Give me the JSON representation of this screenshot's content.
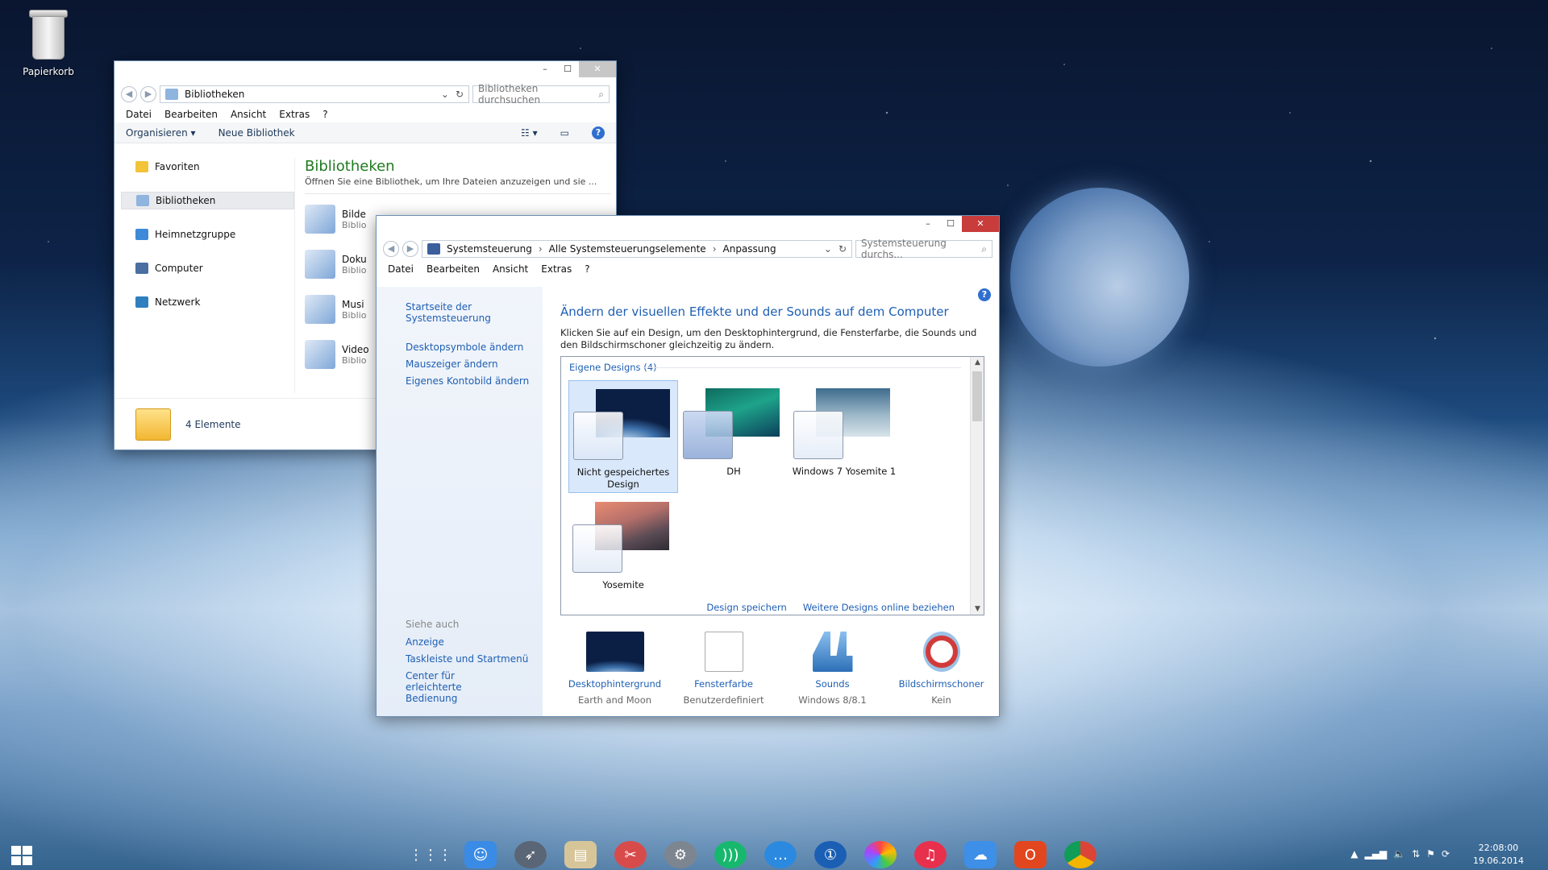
{
  "desktop": {
    "recycle_bin": "Papierkorb"
  },
  "explorer": {
    "title_buttons": {
      "min": "–",
      "max": "☐",
      "close": "✕"
    },
    "breadcrumb": [
      "Bibliotheken"
    ],
    "search_placeholder": "Bibliotheken durchsuchen",
    "menu": [
      "Datei",
      "Bearbeiten",
      "Ansicht",
      "Extras",
      "?"
    ],
    "toolbar": {
      "organize": "Organisieren",
      "new_library": "Neue Bibliothek"
    },
    "nav": [
      "Favoriten",
      "Bibliotheken",
      "Heimnetzgruppe",
      "Computer",
      "Netzwerk"
    ],
    "heading": "Bibliotheken",
    "subtitle": "Öffnen Sie eine Bibliothek, um Ihre Dateien anzuzeigen und sie ...",
    "libraries": [
      {
        "name": "Bilde",
        "type": "Biblio"
      },
      {
        "name": "Doku",
        "type": "Biblio"
      },
      {
        "name": "Musi",
        "type": "Biblio"
      },
      {
        "name": "Video",
        "type": "Biblio"
      }
    ],
    "status": "4 Elemente"
  },
  "control_panel": {
    "breadcrumb": [
      "Systemsteuerung",
      "Alle Systemsteuerungselemente",
      "Anpassung"
    ],
    "search_placeholder": "Systemsteuerung durchs...",
    "menu": [
      "Datei",
      "Bearbeiten",
      "Ansicht",
      "Extras",
      "?"
    ],
    "left_links": [
      "Startseite der Systemsteuerung",
      "Desktopsymbole ändern",
      "Mauszeiger ändern",
      "Eigenes Kontobild ändern"
    ],
    "see_also_heading": "Siehe auch",
    "see_also": [
      "Anzeige",
      "Taskleiste und Startmenü",
      "Center für erleichterte Bedienung"
    ],
    "title": "Ändern der visuellen Effekte und der Sounds auf dem Computer",
    "description": "Klicken Sie auf ein Design, um den Desktophintergrund, die Fensterfarbe, die Sounds und den Bildschirmschoner gleichzeitig zu ändern.",
    "group_heading": "Eigene Designs (4)",
    "themes": [
      "Nicht gespeichertes Design",
      "DH",
      "Windows 7 Yosemite 1",
      "Yosemite"
    ],
    "gallery_links": {
      "save": "Design speichern",
      "online": "Weitere Designs online beziehen"
    },
    "settings": [
      {
        "label": "Desktophintergrund",
        "value": "Earth and Moon"
      },
      {
        "label": "Fensterfarbe",
        "value": "Benutzerdefiniert"
      },
      {
        "label": "Sounds",
        "value": "Windows 8/8.1"
      },
      {
        "label": "Bildschirmschoner",
        "value": "Kein"
      }
    ]
  },
  "taskbar": {
    "time": "22:08:00",
    "date": "19.06.2014"
  }
}
